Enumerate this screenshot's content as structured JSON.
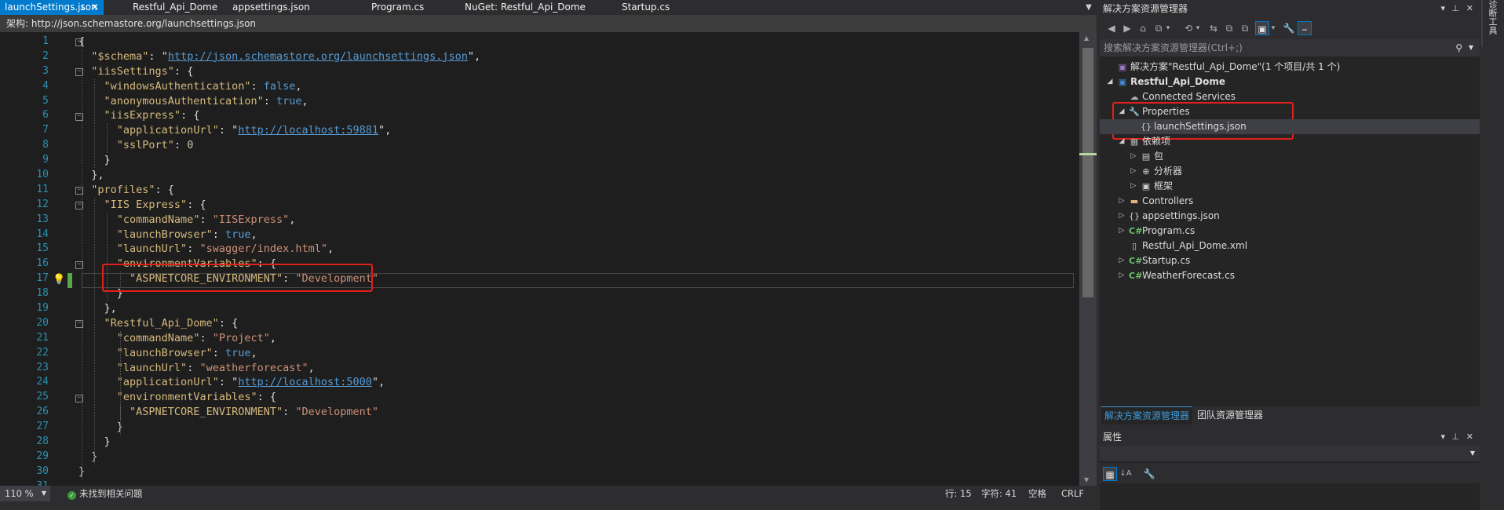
{
  "editor": {
    "tabs": [
      {
        "label": "launchSettings.json",
        "active": true,
        "pinned": true
      },
      {
        "label": "Restful_Api_Dome",
        "active": false
      },
      {
        "label": "appsettings.json",
        "active": false
      },
      {
        "label": "Program.cs",
        "active": false
      },
      {
        "label": "NuGet: Restful_Api_Dome",
        "active": false
      },
      {
        "label": "Startup.cs",
        "active": false
      }
    ],
    "tab_pin_glyph": "⊥",
    "tab_close_glyph": "✕",
    "tab_dropdown_glyph": "▼",
    "schema_bar": "架构: http://json.schemastore.org/launchsettings.json",
    "line_numbers": [
      "1",
      "2",
      "3",
      "4",
      "5",
      "6",
      "7",
      "8",
      "9",
      "10",
      "11",
      "12",
      "13",
      "14",
      "15",
      "16",
      "17",
      "18",
      "19",
      "20",
      "21",
      "22",
      "23",
      "24",
      "25",
      "26",
      "27",
      "28",
      "29",
      "30",
      "31"
    ],
    "code_lines": [
      [
        [
          "p",
          "{"
        ]
      ],
      [
        [
          "p",
          "  "
        ],
        [
          "k",
          "\"$schema\""
        ],
        [
          "p",
          ": "
        ],
        [
          "p",
          "\""
        ],
        [
          "u",
          "http://json.schemastore.org/launchsettings.json"
        ],
        [
          "p",
          "\""
        ],
        [
          "p",
          ","
        ]
      ],
      [
        [
          "p",
          "  "
        ],
        [
          "k",
          "\"iisSettings\""
        ],
        [
          "p",
          ": {"
        ]
      ],
      [
        [
          "p",
          "    "
        ],
        [
          "k",
          "\"windowsAuthentication\""
        ],
        [
          "p",
          ": "
        ],
        [
          "b",
          "false"
        ],
        [
          "p",
          ","
        ]
      ],
      [
        [
          "p",
          "    "
        ],
        [
          "k",
          "\"anonymousAuthentication\""
        ],
        [
          "p",
          ": "
        ],
        [
          "b",
          "true"
        ],
        [
          "p",
          ","
        ]
      ],
      [
        [
          "p",
          "    "
        ],
        [
          "k",
          "\"iisExpress\""
        ],
        [
          "p",
          ": {"
        ]
      ],
      [
        [
          "p",
          "      "
        ],
        [
          "k",
          "\"applicationUrl\""
        ],
        [
          "p",
          ": "
        ],
        [
          "p",
          "\""
        ],
        [
          "u",
          "http://localhost:59881"
        ],
        [
          "p",
          "\""
        ],
        [
          "p",
          ","
        ]
      ],
      [
        [
          "p",
          "      "
        ],
        [
          "k",
          "\"sslPort\""
        ],
        [
          "p",
          ": "
        ],
        [
          "n",
          "0"
        ]
      ],
      [
        [
          "p",
          "    }"
        ]
      ],
      [
        [
          "p",
          "  },"
        ]
      ],
      [
        [
          "p",
          "  "
        ],
        [
          "k",
          "\"profiles\""
        ],
        [
          "p",
          ": {"
        ]
      ],
      [
        [
          "p",
          "    "
        ],
        [
          "k",
          "\"IIS Express\""
        ],
        [
          "p",
          ": {"
        ]
      ],
      [
        [
          "p",
          "      "
        ],
        [
          "k",
          "\"commandName\""
        ],
        [
          "p",
          ": "
        ],
        [
          "s",
          "\"IISExpress\""
        ],
        [
          "p",
          ","
        ]
      ],
      [
        [
          "p",
          "      "
        ],
        [
          "k",
          "\"launchBrowser\""
        ],
        [
          "p",
          ": "
        ],
        [
          "b",
          "true"
        ],
        [
          "p",
          ","
        ]
      ],
      [
        [
          "p",
          "      "
        ],
        [
          "k",
          "\"launchUrl\""
        ],
        [
          "p",
          ": "
        ],
        [
          "s",
          "\"swagger/index.html\""
        ],
        [
          "p",
          ","
        ]
      ],
      [
        [
          "p",
          "      "
        ],
        [
          "k",
          "\"environmentVariables\""
        ],
        [
          "p",
          ": {"
        ]
      ],
      [
        [
          "p",
          "        "
        ],
        [
          "k",
          "\"ASPNETCORE_ENVIRONMENT\""
        ],
        [
          "p",
          ": "
        ],
        [
          "s",
          "\"Development\""
        ]
      ],
      [
        [
          "p",
          "      }"
        ]
      ],
      [
        [
          "p",
          "    },"
        ]
      ],
      [
        [
          "p",
          "    "
        ],
        [
          "k",
          "\"Restful_Api_Dome\""
        ],
        [
          "p",
          ": {"
        ]
      ],
      [
        [
          "p",
          "      "
        ],
        [
          "k",
          "\"commandName\""
        ],
        [
          "p",
          ": "
        ],
        [
          "s",
          "\"Project\""
        ],
        [
          "p",
          ","
        ]
      ],
      [
        [
          "p",
          "      "
        ],
        [
          "k",
          "\"launchBrowser\""
        ],
        [
          "p",
          ": "
        ],
        [
          "b",
          "true"
        ],
        [
          "p",
          ","
        ]
      ],
      [
        [
          "p",
          "      "
        ],
        [
          "k",
          "\"launchUrl\""
        ],
        [
          "p",
          ": "
        ],
        [
          "s",
          "\"weatherforecast\""
        ],
        [
          "p",
          ","
        ]
      ],
      [
        [
          "p",
          "      "
        ],
        [
          "k",
          "\"applicationUrl\""
        ],
        [
          "p",
          ": "
        ],
        [
          "p",
          "\""
        ],
        [
          "u",
          "http://localhost:5000"
        ],
        [
          "p",
          "\""
        ],
        [
          "p",
          ","
        ]
      ],
      [
        [
          "p",
          "      "
        ],
        [
          "k",
          "\"environmentVariables\""
        ],
        [
          "p",
          ": {"
        ]
      ],
      [
        [
          "p",
          "        "
        ],
        [
          "k",
          "\"ASPNETCORE_ENVIRONMENT\""
        ],
        [
          "p",
          ": "
        ],
        [
          "s",
          "\"Development\""
        ]
      ],
      [
        [
          "p",
          "      }"
        ]
      ],
      [
        [
          "p",
          "    }"
        ]
      ],
      [
        [
          "p",
          "  }"
        ]
      ],
      [
        [
          "p",
          "}"
        ]
      ],
      [
        [
          "p",
          ""
        ]
      ]
    ],
    "fold_glyph": "−",
    "lightbulb_glyph": "💡"
  },
  "statusbar": {
    "zoom": "110 %",
    "issues_glyph": "✓",
    "issues": "未找到相关问题",
    "row": "行: 15",
    "col": "字符: 41",
    "spaces": "空格",
    "line_ending": "CRLF",
    "dropdown_glyph": "▼"
  },
  "solution_explorer": {
    "title": "解决方案资源管理器",
    "title_controls": [
      "▾",
      "⊥",
      "✕"
    ],
    "toolbar_icons": [
      "◀",
      "▶",
      "⌂",
      "⧉",
      "▾",
      "⟲",
      "▾",
      "⇆",
      "⧉",
      "⧉",
      "▣",
      "▾",
      "🔧",
      "⎯"
    ],
    "search_placeholder": "搜索解决方案资源管理器(Ctrl+;)",
    "search_glyph": "⚲",
    "search_dropdown_glyph": "▼",
    "tree": [
      {
        "label": "解决方案\"Restful_Api_Dome\"(1 个项目/共 1 个)",
        "level": 0,
        "arrow": "",
        "icon": "▣",
        "icon_color": "#a07ad0"
      },
      {
        "label": "Restful_Api_Dome",
        "level": 0,
        "arrow": "◢",
        "icon": "▣",
        "icon_color": "#3f8cd8",
        "bold": true
      },
      {
        "label": "Connected Services",
        "level": 1,
        "arrow": "",
        "icon": "☁",
        "icon_color": "#b0b0b0"
      },
      {
        "label": "Properties",
        "level": 1,
        "arrow": "◢",
        "icon": "🔧",
        "icon_color": "#cfcfcf"
      },
      {
        "label": "launchSettings.json",
        "level": 2,
        "arrow": "",
        "icon": "{}",
        "icon_color": "#cfcfcf",
        "selected": true
      },
      {
        "label": "依赖项",
        "level": 1,
        "arrow": "◢",
        "icon": "▦",
        "icon_color": "#b0b0b0"
      },
      {
        "label": "包",
        "level": 2,
        "arrow": "▷",
        "icon": "▤",
        "icon_color": "#cfcfcf"
      },
      {
        "label": "分析器",
        "level": 2,
        "arrow": "▷",
        "icon": "⊕",
        "icon_color": "#cfcfcf"
      },
      {
        "label": "框架",
        "level": 2,
        "arrow": "▷",
        "icon": "▣",
        "icon_color": "#cfcfcf"
      },
      {
        "label": "Controllers",
        "level": 1,
        "arrow": "▷",
        "icon": "▬",
        "icon_color": "#dcb67a"
      },
      {
        "label": "appsettings.json",
        "level": 1,
        "arrow": "▷",
        "icon": "{}",
        "icon_color": "#cfcfcf"
      },
      {
        "label": "Program.cs",
        "level": 1,
        "arrow": "▷",
        "icon": "C#",
        "icon_color": "#6ac069"
      },
      {
        "label": "Restful_Api_Dome.xml",
        "level": 1,
        "arrow": "",
        "icon": "▯",
        "icon_color": "#cfcfcf"
      },
      {
        "label": "Startup.cs",
        "level": 1,
        "arrow": "▷",
        "icon": "C#",
        "icon_color": "#6ac069"
      },
      {
        "label": "WeatherForecast.cs",
        "level": 1,
        "arrow": "▷",
        "icon": "C#",
        "icon_color": "#6ac069"
      }
    ],
    "bottom_tabs": [
      {
        "label": "解决方案资源管理器",
        "active": true
      },
      {
        "label": "团队资源管理器",
        "active": false
      }
    ]
  },
  "properties": {
    "title": "属性",
    "title_controls": [
      "▾",
      "⊥",
      "✕"
    ],
    "combo_dropdown_glyph": "▼",
    "toolbar_icons": [
      "▦",
      "↓A",
      "🔧"
    ]
  },
  "right_rail": {
    "label": "诊断工具"
  },
  "colors": {
    "accent": "#007acc",
    "highlight_box": "#e0201b",
    "editor_bg": "#1e1e1e",
    "panel_bg": "#252526"
  }
}
